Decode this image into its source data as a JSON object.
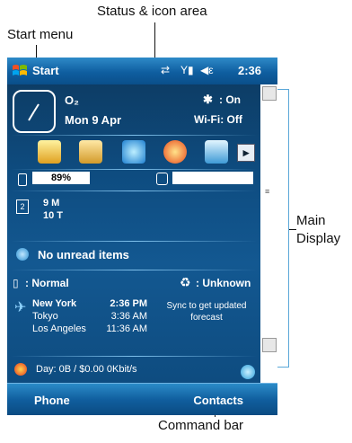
{
  "annotations": {
    "status_area": "Status & icon area",
    "start_menu": "Start menu",
    "main_display": "Main Display",
    "command_bar": "Command bar"
  },
  "titlebar": {
    "start_label": "Start",
    "time": "2:36"
  },
  "today": {
    "owner": "O₂",
    "date": "Mon 9 Apr",
    "bluetooth": ": On",
    "wifi": "Wi-Fi: Off",
    "battery": "89%",
    "tasks": [
      "9 M",
      "10 T"
    ],
    "messages": "No unread items",
    "profile": ": Normal",
    "sync_status": ": Unknown",
    "weather": {
      "cities": [
        {
          "city": "New York",
          "time": "2:36 PM"
        },
        {
          "city": "Tokyo",
          "time": "3:36 AM"
        },
        {
          "city": "Los Angeles",
          "time": "11:36 AM"
        }
      ],
      "sync_note": "Sync to get updated forecast"
    },
    "day_usage": "Day: 0B / $0.00  0Kbit/s"
  },
  "command_bar": {
    "left": "Phone",
    "right": "Contacts"
  }
}
